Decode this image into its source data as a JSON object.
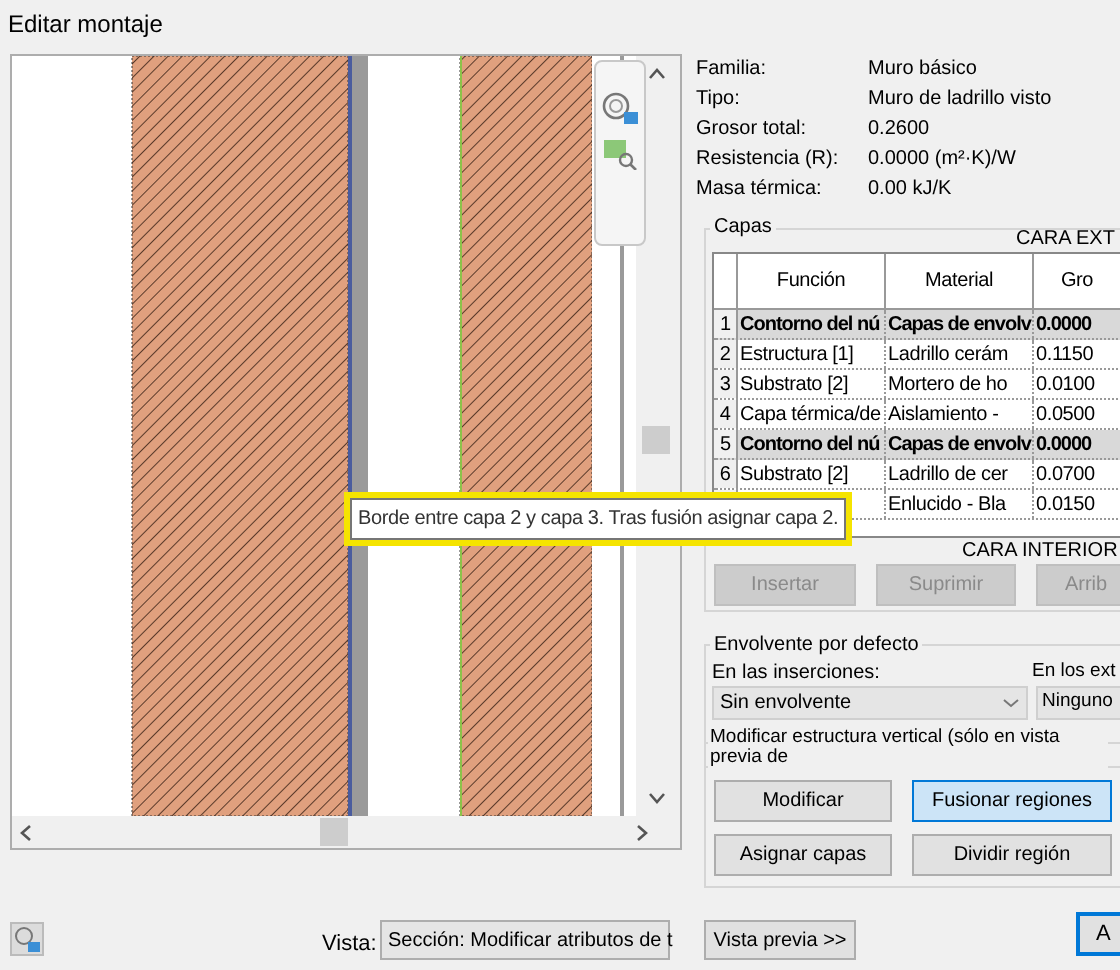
{
  "window": {
    "title": "Editar montaje"
  },
  "properties": [
    {
      "label": "Familia:",
      "value": "Muro básico"
    },
    {
      "label": "Tipo:",
      "value": "Muro de ladrillo visto"
    },
    {
      "label": "Grosor total:",
      "value": "0.2600"
    },
    {
      "label": "Resistencia (R):",
      "value": "0.0000 (m²·K)/W"
    },
    {
      "label": "Masa térmica:",
      "value": "0.00 kJ/K"
    }
  ],
  "layers": {
    "title": "Capas",
    "exterior_label": "CARA EXT",
    "columns": [
      "Función",
      "Material",
      "Gro"
    ],
    "rows": [
      {
        "kind": "core",
        "number": "1",
        "function": "Contorno del nú",
        "material": "Capas de envolv",
        "thickness": "0.0000"
      },
      {
        "kind": "layer",
        "number": "2",
        "function": "Estructura [1]",
        "material": "Ladrillo cerám",
        "thickness": "0.1150"
      },
      {
        "kind": "layer",
        "number": "3",
        "function": "Substrato [2]",
        "material": "Mortero de ho",
        "thickness": "0.0100"
      },
      {
        "kind": "layer",
        "number": "4",
        "function": "Capa térmica/de",
        "material": "Aislamiento -",
        "thickness": "0.0500"
      },
      {
        "kind": "core",
        "number": "5",
        "function": "Contorno del nú",
        "material": "Capas de envolv",
        "thickness": "0.0000"
      },
      {
        "kind": "layer",
        "number": "6",
        "function": "Substrato [2]",
        "material": "Ladrillo de cer",
        "thickness": "0.0700"
      },
      {
        "kind": "layer",
        "material": "Enlucido - Bla",
        "thickness": "0.0150"
      }
    ],
    "interior_label": "CARA INTERIOR",
    "buttons": [
      {
        "label": "Insertar",
        "disabled": true
      },
      {
        "label": "Suprimir",
        "disabled": true
      },
      {
        "label": "Arrib",
        "disabled": true
      }
    ]
  },
  "wrapping": {
    "title": "Envolvente por defecto",
    "inserts_label": "En las inserciones:",
    "inserts_value": "Sin envolvente",
    "ends_label": "En los ext",
    "ends_value": "Ninguno"
  },
  "vertical": {
    "title": "Modificar estructura vertical (sólo en vista previa de",
    "buttons": [
      {
        "label": "Modificar",
        "selected": false
      },
      {
        "label": "Fusionar regiones",
        "selected": true
      },
      {
        "label": "Asignar capas",
        "selected": false
      },
      {
        "label": "Dividir región",
        "selected": false
      }
    ]
  },
  "tooltip": "Borde entre capa 2 y capa 3. Tras fusión asignar capa 2.",
  "view": {
    "label": "Vista:",
    "value": "Sección: Modificar atributos de t"
  },
  "preview_button": "Vista previa >>",
  "ok_button": "A"
}
